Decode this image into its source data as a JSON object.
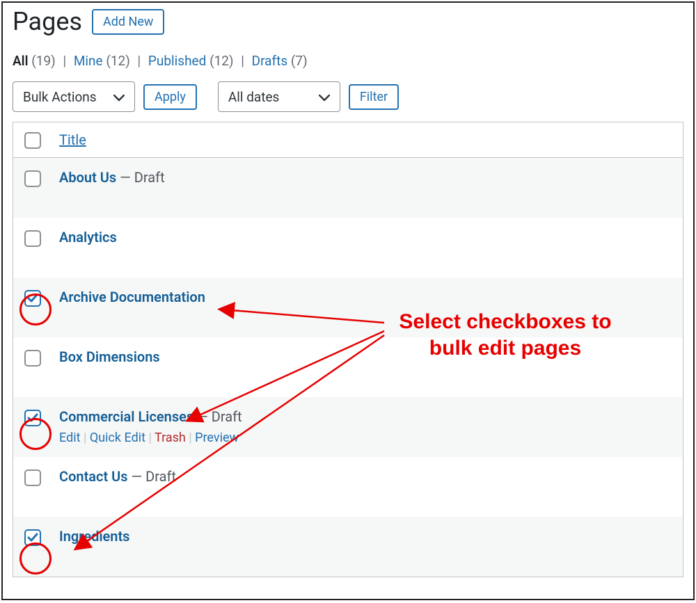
{
  "header": {
    "title": "Pages",
    "add_new": "Add New"
  },
  "filters": {
    "all_label": "All",
    "all_count": "(19)",
    "mine_label": "Mine",
    "mine_count": "(12)",
    "published_label": "Published",
    "published_count": "(12)",
    "drafts_label": "Drafts",
    "drafts_count": "(7)",
    "sep": "|"
  },
  "toolbar": {
    "bulk_actions": "Bulk Actions",
    "apply": "Apply",
    "all_dates": "All dates",
    "filter": "Filter"
  },
  "table": {
    "title_header": "Title",
    "status_sep": " — ",
    "draft": "Draft",
    "actions": {
      "edit": "Edit",
      "quick_edit": "Quick Edit",
      "trash": "Trash",
      "preview": "Preview",
      "sep": " | "
    },
    "rows": [
      {
        "title": "About Us",
        "draft": true,
        "checked": false,
        "show_actions": false
      },
      {
        "title": "Analytics",
        "draft": false,
        "checked": false,
        "show_actions": false
      },
      {
        "title": "Archive Documentation",
        "draft": false,
        "checked": true,
        "show_actions": false
      },
      {
        "title": "Box Dimensions",
        "draft": false,
        "checked": false,
        "show_actions": false
      },
      {
        "title": "Commercial Licenses",
        "draft": true,
        "checked": true,
        "show_actions": true
      },
      {
        "title": "Contact Us",
        "draft": true,
        "checked": false,
        "show_actions": false
      },
      {
        "title": "Ingredients",
        "draft": false,
        "checked": true,
        "show_actions": false
      }
    ]
  },
  "annotation": {
    "line1": "Select checkboxes to",
    "line2": "bulk edit pages"
  }
}
